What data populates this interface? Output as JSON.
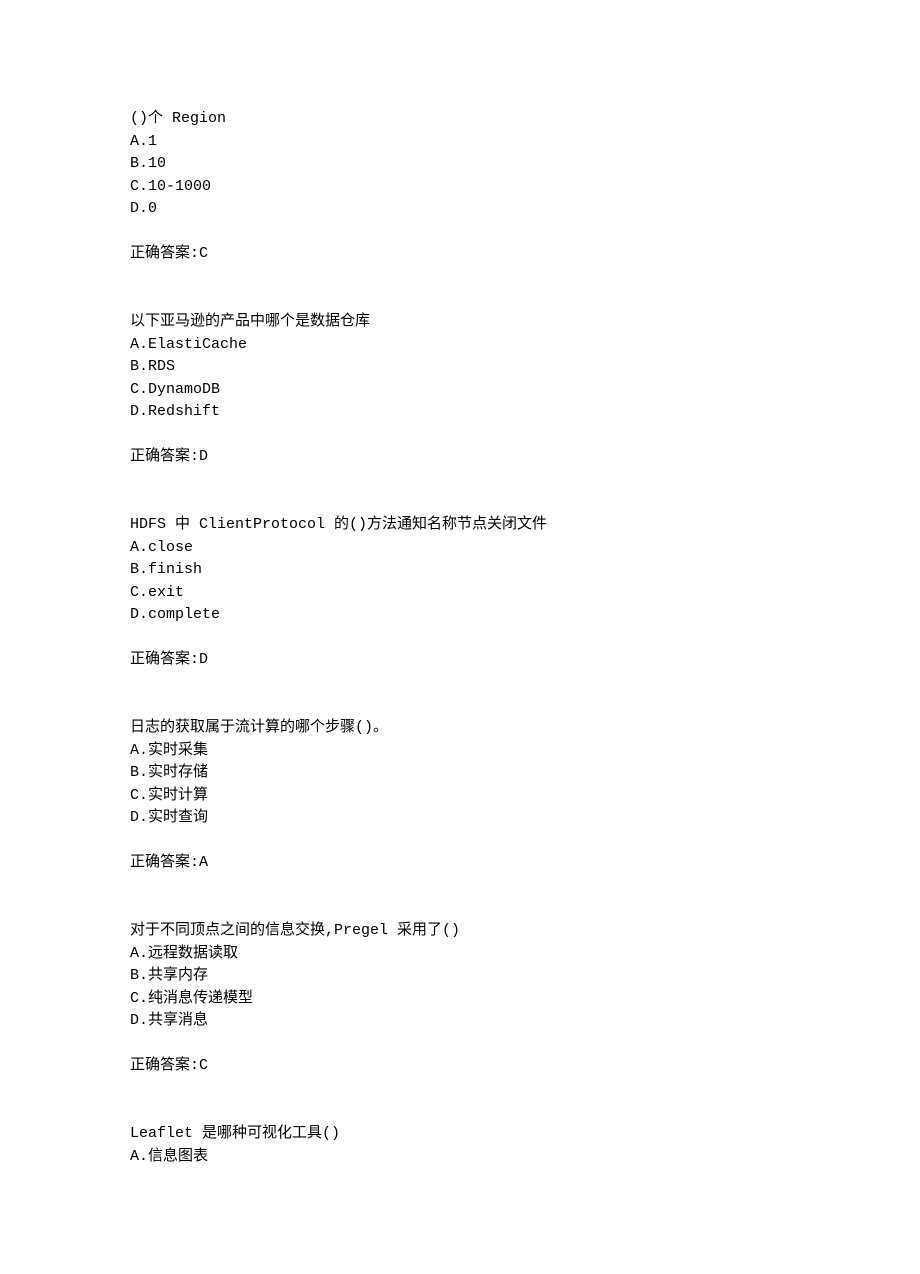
{
  "questions": [
    {
      "stem": "()个 Region",
      "options": [
        "A.1",
        "B.10",
        "C.10-1000",
        "D.0"
      ],
      "answer": "正确答案:C"
    },
    {
      "stem": "以下亚马逊的产品中哪个是数据仓库",
      "options": [
        "A.ElastiCache",
        "B.RDS",
        "C.DynamoDB",
        "D.Redshift"
      ],
      "answer": "正确答案:D"
    },
    {
      "stem": "HDFS 中 ClientProtocol 的()方法通知名称节点关闭文件",
      "options": [
        "A.close",
        "B.finish",
        "C.exit",
        "D.complete"
      ],
      "answer": "正确答案:D"
    },
    {
      "stem": "日志的获取属于流计算的哪个步骤()。",
      "options": [
        "A.实时采集",
        "B.实时存储",
        "C.实时计算",
        "D.实时查询"
      ],
      "answer": "正确答案:A"
    },
    {
      "stem": "对于不同顶点之间的信息交换,Pregel 采用了()",
      "options": [
        "A.远程数据读取",
        "B.共享内存",
        "C.纯消息传递模型",
        "D.共享消息"
      ],
      "answer": "正确答案:C"
    },
    {
      "stem": "Leaflet 是哪种可视化工具()",
      "options": [
        "A.信息图表"
      ],
      "answer": ""
    }
  ]
}
